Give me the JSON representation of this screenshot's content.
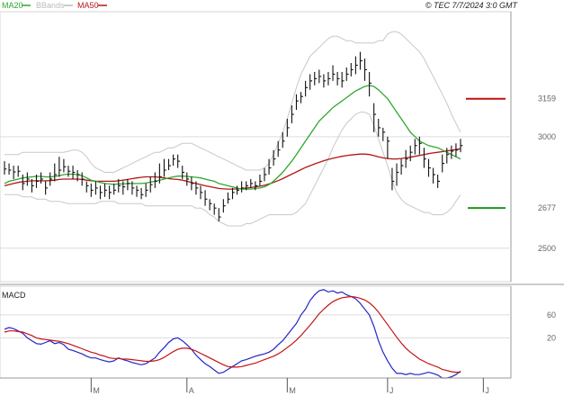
{
  "header": {
    "legend": [
      {
        "label": "MA20",
        "color": "#2fa82f"
      },
      {
        "label": "BBands",
        "color": "#bbbbbb"
      },
      {
        "label": "MA50",
        "color": "#b01818"
      }
    ],
    "timestamp": "© TEC 7/7/2024 3:0 GMT"
  },
  "chart_data": [
    {
      "type": "candlestick",
      "panel": "price",
      "y_ticks": [
        "3000",
        "2500"
      ],
      "ylim": [
        2350,
        3560
      ],
      "x_ticks": [
        "M",
        "A",
        "M",
        "J",
        "J"
      ],
      "x_tick_index": [
        19,
        40,
        62,
        84,
        105
      ],
      "grid": true,
      "closes": [
        2855,
        2850,
        2842,
        2845,
        2790,
        2810,
        2780,
        2800,
        2810,
        2770,
        2810,
        2830,
        2850,
        2865,
        2845,
        2840,
        2830,
        2810,
        2780,
        2760,
        2770,
        2750,
        2760,
        2750,
        2760,
        2780,
        2775,
        2790,
        2770,
        2760,
        2740,
        2760,
        2785,
        2800,
        2820,
        2850,
        2870,
        2900,
        2890,
        2840,
        2810,
        2790,
        2770,
        2750,
        2720,
        2700,
        2680,
        2640,
        2690,
        2720,
        2750,
        2760,
        2770,
        2780,
        2790,
        2780,
        2800,
        2830,
        2860,
        2900,
        2940,
        2980,
        3040,
        3100,
        3160,
        3180,
        3220,
        3250,
        3260,
        3270,
        3250,
        3260,
        3280,
        3260,
        3250,
        3280,
        3300,
        3320,
        3340,
        3300,
        3240,
        3100,
        3040,
        3020,
        2980,
        2800,
        2840,
        2870,
        2900,
        2930,
        2960,
        2970,
        2900,
        2860,
        2830,
        2800,
        2880,
        2920,
        2935,
        2940,
        2960
      ],
      "highs": [
        2890,
        2880,
        2870,
        2870,
        2830,
        2840,
        2810,
        2830,
        2840,
        2800,
        2840,
        2880,
        2910,
        2900,
        2870,
        2870,
        2850,
        2840,
        2800,
        2790,
        2800,
        2780,
        2790,
        2780,
        2790,
        2810,
        2800,
        2810,
        2800,
        2780,
        2770,
        2790,
        2820,
        2840,
        2880,
        2900,
        2900,
        2920,
        2920,
        2870,
        2840,
        2820,
        2800,
        2780,
        2760,
        2720,
        2700,
        2680,
        2720,
        2750,
        2770,
        2780,
        2800,
        2800,
        2810,
        2800,
        2830,
        2860,
        2900,
        2940,
        2980,
        3020,
        3080,
        3140,
        3190,
        3200,
        3250,
        3280,
        3290,
        3300,
        3280,
        3290,
        3320,
        3290,
        3290,
        3310,
        3330,
        3360,
        3380,
        3350,
        3290,
        3150,
        3080,
        3040,
        3000,
        2860,
        2880,
        2900,
        2940,
        2960,
        2990,
        3000,
        2950,
        2900,
        2860,
        2830,
        2920,
        2950,
        2960,
        2970,
        2990
      ],
      "lows": [
        2830,
        2830,
        2810,
        2820,
        2760,
        2780,
        2750,
        2770,
        2790,
        2740,
        2780,
        2800,
        2820,
        2840,
        2820,
        2810,
        2800,
        2780,
        2750,
        2730,
        2740,
        2720,
        2730,
        2720,
        2740,
        2750,
        2740,
        2760,
        2740,
        2730,
        2720,
        2730,
        2750,
        2770,
        2790,
        2820,
        2850,
        2870,
        2860,
        2810,
        2780,
        2760,
        2740,
        2720,
        2690,
        2670,
        2650,
        2620,
        2660,
        2700,
        2720,
        2740,
        2750,
        2760,
        2770,
        2760,
        2780,
        2800,
        2830,
        2870,
        2910,
        2950,
        3000,
        3060,
        3120,
        3150,
        3180,
        3210,
        3230,
        3240,
        3220,
        3230,
        3250,
        3230,
        3220,
        3250,
        3270,
        3280,
        3300,
        3250,
        3180,
        3020,
        3000,
        2980,
        2900,
        2760,
        2780,
        2830,
        2860,
        2890,
        2920,
        2920,
        2860,
        2820,
        2790,
        2770,
        2840,
        2880,
        2900,
        2910,
        2930
      ],
      "bband_upper": [
        2920,
        2920,
        2920,
        2920,
        2930,
        2930,
        2930,
        2930,
        2930,
        2930,
        2930,
        2930,
        2930,
        2930,
        2935,
        2940,
        2940,
        2930,
        2910,
        2880,
        2860,
        2850,
        2840,
        2840,
        2840,
        2850,
        2860,
        2870,
        2880,
        2890,
        2900,
        2910,
        2920,
        2930,
        2930,
        2940,
        2950,
        2950,
        2960,
        2970,
        2970,
        2970,
        2960,
        2950,
        2940,
        2930,
        2920,
        2910,
        2900,
        2890,
        2880,
        2870,
        2860,
        2850,
        2850,
        2850,
        2850,
        2860,
        2880,
        2920,
        2970,
        3020,
        3080,
        3150,
        3220,
        3280,
        3320,
        3360,
        3380,
        3400,
        3420,
        3440,
        3450,
        3450,
        3440,
        3430,
        3430,
        3420,
        3420,
        3420,
        3420,
        3420,
        3430,
        3430,
        3460,
        3470,
        3470,
        3460,
        3440,
        3420,
        3400,
        3380,
        3350,
        3310,
        3270,
        3230,
        3190,
        3150,
        3100,
        3060,
        3020
      ],
      "bband_lower": [
        2740,
        2740,
        2740,
        2740,
        2730,
        2730,
        2730,
        2720,
        2720,
        2720,
        2710,
        2710,
        2710,
        2705,
        2700,
        2700,
        2700,
        2700,
        2700,
        2700,
        2700,
        2710,
        2710,
        2710,
        2710,
        2700,
        2700,
        2700,
        2700,
        2700,
        2700,
        2690,
        2690,
        2690,
        2690,
        2690,
        2690,
        2690,
        2690,
        2690,
        2690,
        2690,
        2680,
        2680,
        2670,
        2650,
        2640,
        2620,
        2610,
        2600,
        2600,
        2600,
        2600,
        2610,
        2610,
        2620,
        2630,
        2640,
        2650,
        2650,
        2650,
        2650,
        2650,
        2650,
        2660,
        2680,
        2700,
        2740,
        2780,
        2820,
        2860,
        2900,
        2950,
        2990,
        3030,
        3060,
        3080,
        3100,
        3110,
        3110,
        3100,
        3050,
        2990,
        2930,
        2870,
        2800,
        2750,
        2720,
        2700,
        2690,
        2680,
        2670,
        2660,
        2660,
        2650,
        2650,
        2650,
        2660,
        2680,
        2710,
        2740
      ],
      "ma20": [
        2790,
        2800,
        2805,
        2810,
        2815,
        2818,
        2820,
        2822,
        2822,
        2820,
        2820,
        2822,
        2825,
        2830,
        2832,
        2832,
        2830,
        2825,
        2815,
        2805,
        2800,
        2795,
        2790,
        2788,
        2786,
        2788,
        2788,
        2790,
        2790,
        2790,
        2790,
        2792,
        2796,
        2800,
        2805,
        2810,
        2815,
        2820,
        2823,
        2823,
        2822,
        2820,
        2818,
        2815,
        2810,
        2805,
        2800,
        2790,
        2785,
        2780,
        2775,
        2770,
        2765,
        2765,
        2765,
        2768,
        2770,
        2775,
        2785,
        2800,
        2820,
        2840,
        2865,
        2890,
        2920,
        2950,
        2980,
        3010,
        3040,
        3070,
        3090,
        3110,
        3130,
        3145,
        3160,
        3175,
        3190,
        3205,
        3215,
        3225,
        3230,
        3225,
        3210,
        3190,
        3170,
        3140,
        3110,
        3080,
        3050,
        3020,
        3000,
        2980,
        2970,
        2960,
        2955,
        2950,
        2940,
        2930,
        2920,
        2910,
        2900
      ],
      "ma50": [
        2780,
        2785,
        2790,
        2795,
        2798,
        2800,
        2802,
        2802,
        2802,
        2802,
        2803,
        2805,
        2808,
        2810,
        2810,
        2810,
        2810,
        2808,
        2805,
        2802,
        2800,
        2800,
        2800,
        2800,
        2800,
        2802,
        2805,
        2808,
        2812,
        2815,
        2818,
        2820,
        2820,
        2820,
        2818,
        2815,
        2812,
        2810,
        2808,
        2805,
        2800,
        2795,
        2790,
        2785,
        2780,
        2776,
        2772,
        2768,
        2766,
        2765,
        2765,
        2766,
        2768,
        2770,
        2772,
        2775,
        2778,
        2782,
        2788,
        2795,
        2803,
        2812,
        2822,
        2832,
        2842,
        2852,
        2862,
        2870,
        2878,
        2885,
        2892,
        2898,
        2903,
        2908,
        2912,
        2915,
        2918,
        2920,
        2922,
        2922,
        2920,
        2915,
        2910,
        2905,
        2902,
        2900,
        2900,
        2902,
        2905,
        2908,
        2912,
        2916,
        2920,
        2924,
        2927,
        2930,
        2933,
        2936,
        2939,
        2942,
        2946
      ],
      "levels": [
        {
          "label": "3159",
          "value": 3170,
          "color": "#c41010"
        },
        {
          "label": "2677",
          "value": 2680,
          "color": "#1a9a1a"
        }
      ]
    },
    {
      "type": "line",
      "panel": "macd",
      "title": "MACD",
      "y_ticks": [
        "60",
        "20"
      ],
      "ylim": [
        -50,
        110
      ],
      "grid": true,
      "series": [
        {
          "color": "#2424c8",
          "values": [
            35,
            38,
            36,
            32,
            28,
            20,
            15,
            10,
            9,
            12,
            15,
            10,
            12,
            8,
            0,
            -2,
            -5,
            -8,
            -12,
            -15,
            -15,
            -18,
            -20,
            -22,
            -20,
            -15,
            -18,
            -20,
            -23,
            -25,
            -27,
            -25,
            -20,
            -15,
            -5,
            3,
            12,
            18,
            20,
            15,
            8,
            0,
            -10,
            -18,
            -25,
            -30,
            -36,
            -42,
            -40,
            -35,
            -30,
            -25,
            -20,
            -18,
            -15,
            -12,
            -10,
            -8,
            -5,
            0,
            8,
            15,
            25,
            35,
            45,
            60,
            70,
            85,
            95,
            102,
            104,
            100,
            102,
            98,
            100,
            95,
            92,
            88,
            80,
            70,
            60,
            40,
            15,
            -5,
            -20,
            -33,
            -42,
            -42,
            -44,
            -42,
            -44,
            -44,
            -42,
            -40,
            -42,
            -45,
            -50,
            -50,
            -48,
            -44,
            -38
          ]
        },
        {
          "color": "#c41414",
          "values": [
            30,
            32,
            32,
            31,
            30,
            27,
            24,
            20,
            18,
            17,
            16,
            15,
            14,
            12,
            10,
            7,
            4,
            1,
            -2,
            -5,
            -7,
            -10,
            -12,
            -15,
            -16,
            -16,
            -17,
            -17,
            -18,
            -19,
            -20,
            -21,
            -21,
            -20,
            -18,
            -14,
            -9,
            -4,
            0,
            2,
            2,
            0,
            -3,
            -7,
            -11,
            -15,
            -19,
            -23,
            -27,
            -30,
            -31,
            -31,
            -30,
            -28,
            -26,
            -24,
            -21,
            -18,
            -15,
            -12,
            -8,
            -3,
            3,
            9,
            16,
            24,
            33,
            42,
            52,
            62,
            70,
            77,
            83,
            87,
            90,
            91,
            92,
            91,
            89,
            86,
            81,
            74,
            65,
            54,
            43,
            32,
            21,
            11,
            2,
            -5,
            -11,
            -17,
            -21,
            -25,
            -28,
            -31,
            -35,
            -37,
            -39,
            -40,
            -40
          ]
        }
      ]
    }
  ]
}
